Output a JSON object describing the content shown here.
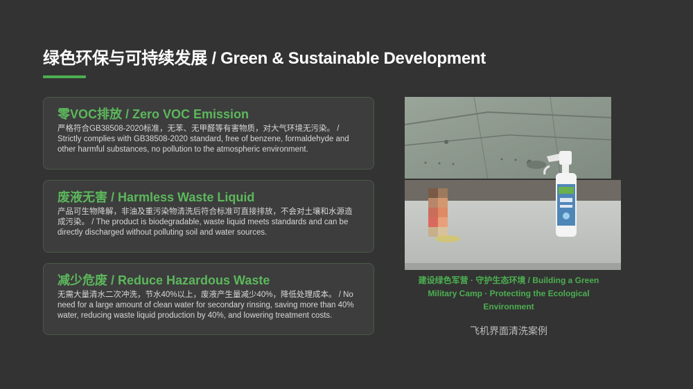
{
  "header": {
    "title": "绿色环保与可持续发展 / Green & Sustainable Development"
  },
  "cards": [
    {
      "title": "零VOC排放 / Zero VOC Emission",
      "body": "严格符合GB38508-2020标准，无苯、无甲醛等有害物质，对大气环境无污染。 / Strictly complies with GB38508-2020 standard, free of benzene, formaldehyde and other harmful substances, no pollution to the atmospheric environment."
    },
    {
      "title": "废液无害 / Harmless Waste Liquid",
      "body": "产品可生物降解，非油及重污染物清洗后符合标准可直接排放，不会对土壤和水源造成污染。 / The product is biodegradable, waste liquid meets standards and can be directly discharged without polluting soil and water sources."
    },
    {
      "title": "减少危废 / Reduce Hazardous Waste",
      "body": "无需大量清水二次冲洗，节水40%以上，废液产生量减少40%，降低处理成本。 / No need for a large amount of clean water for secondary rinsing, saving more than 40% water, reducing waste liquid production by 40%, and lowering treatment costs."
    }
  ],
  "photo": {
    "caption": "建设绿色军营 · 守护生态环境 / Building a Green Military Camp · Protecting the Ecological Environment",
    "subcaption": "飞机界面清洗案例"
  },
  "colors": {
    "background": "#333333",
    "accent": "#4caf50",
    "card_background": "#3d3d3d",
    "card_border": "#4a5a48"
  }
}
